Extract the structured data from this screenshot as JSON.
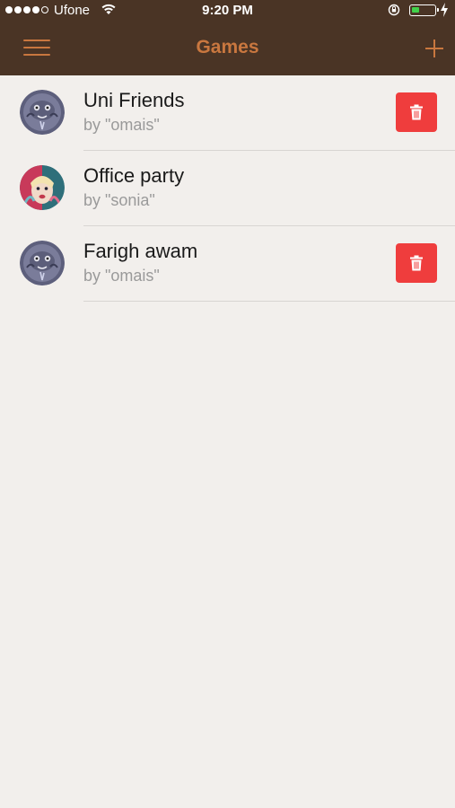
{
  "status_bar": {
    "carrier": "Ufone",
    "time": "9:20 PM",
    "battery_percent": 25
  },
  "navbar": {
    "title": "Games",
    "menu_icon": "hamburger-menu-icon",
    "add_icon": "plus-icon"
  },
  "colors": {
    "bar_background": "#4a3425",
    "accent": "#c9773f",
    "page_background": "#f2efec",
    "delete_red": "#ef3d3d"
  },
  "games": [
    {
      "title": "Uni Friends",
      "owner": "by \"omais\"",
      "avatar": "cartoon-avatar",
      "deletable": true
    },
    {
      "title": "Office party",
      "owner": "by \"sonia\"",
      "avatar": "photo-avatar",
      "deletable": false
    },
    {
      "title": "Farigh awam",
      "owner": "by \"omais\"",
      "avatar": "cartoon-avatar",
      "deletable": true
    }
  ]
}
